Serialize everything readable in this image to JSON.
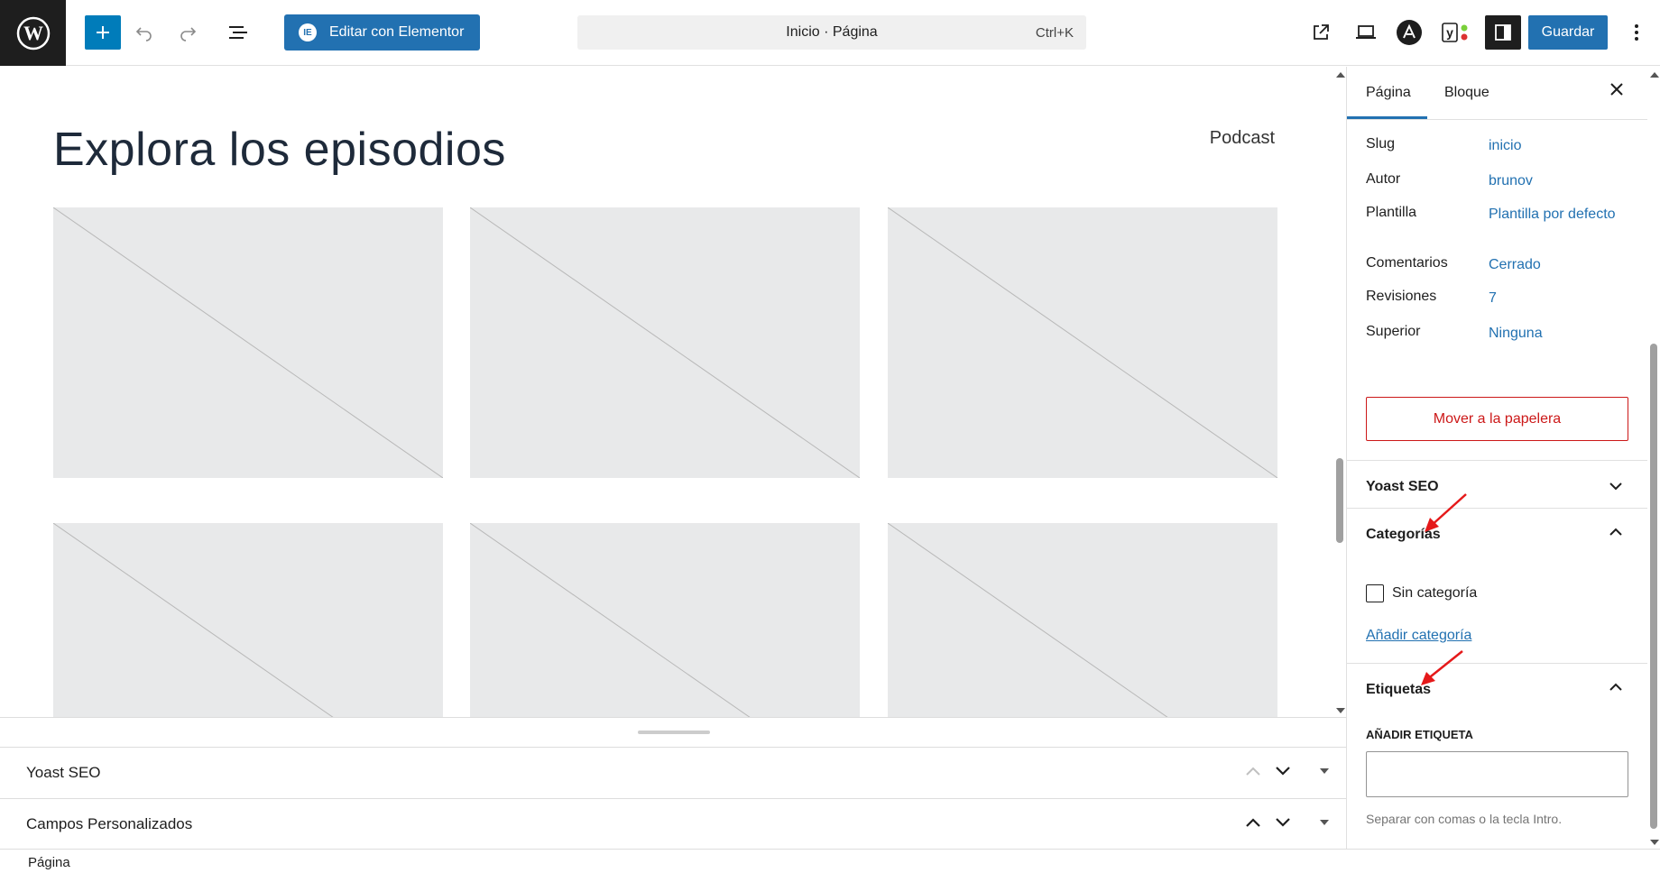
{
  "toolbar": {
    "elementor_label": "Editar con Elementor",
    "command_text": "Inicio · Página",
    "command_shortcut": "Ctrl+K",
    "save_label": "Guardar"
  },
  "canvas": {
    "heading": "Explora los episodios",
    "nav_link": "Podcast"
  },
  "meta_boxes": [
    {
      "label": "Yoast SEO"
    },
    {
      "label": "Campos Personalizados"
    }
  ],
  "footer": {
    "breadcrumb": "Página"
  },
  "sidebar": {
    "tabs": [
      "Página",
      "Bloque"
    ],
    "summary": [
      {
        "key": "Slug",
        "value": "inicio"
      },
      {
        "key": "Autor",
        "value": "brunov"
      },
      {
        "key": "Plantilla",
        "value": "Plantilla por defecto"
      },
      {
        "key": "Comentarios",
        "value": "Cerrado"
      },
      {
        "key": "Revisiones",
        "value": "7"
      },
      {
        "key": "Superior",
        "value": "Ninguna"
      }
    ],
    "trash_label": "Mover a la papelera",
    "yoast_title": "Yoast SEO",
    "categories": {
      "title": "Categorías",
      "items": [
        {
          "label": "Sin categoría",
          "checked": false
        }
      ],
      "add_link": "Añadir categoría"
    },
    "tags": {
      "title": "Etiquetas",
      "add_label": "Añadir etiqueta",
      "input_value": "",
      "help": "Separar con comas o la tecla Intro."
    }
  },
  "colors": {
    "accent": "#2271b1",
    "danger": "#cc1818",
    "annotation_arrow": "#e5191a"
  }
}
